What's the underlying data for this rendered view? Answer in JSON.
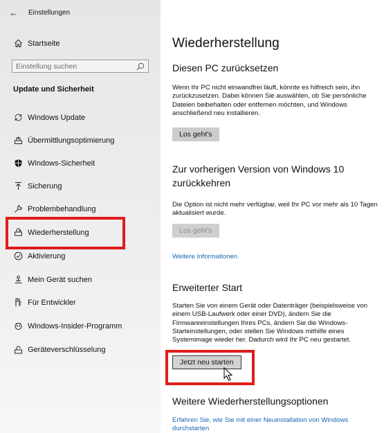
{
  "window": {
    "title": "Einstellungen"
  },
  "sidebar": {
    "home_label": "Startseite",
    "search_placeholder": "Einstellung suchen",
    "section_title": "Update und Sicherheit",
    "items": [
      {
        "label": "Windows Update",
        "icon": "sync-icon"
      },
      {
        "label": "Übermittlungsoptimierung",
        "icon": "delivery-optimization-icon"
      },
      {
        "label": "Windows-Sicherheit",
        "icon": "shield-icon"
      },
      {
        "label": "Sicherung",
        "icon": "backup-arrow-icon"
      },
      {
        "label": "Problembehandlung",
        "icon": "wrench-icon"
      },
      {
        "label": "Wiederherstellung",
        "icon": "recovery-icon",
        "selected": true
      },
      {
        "label": "Aktivierung",
        "icon": "check-circle-icon"
      },
      {
        "label": "Mein Gerät suchen",
        "icon": "find-device-icon"
      },
      {
        "label": "Für Entwickler",
        "icon": "developer-icon"
      },
      {
        "label": "Windows-Insider-Programm",
        "icon": "insider-icon"
      },
      {
        "label": "Geräteverschlüsselung",
        "icon": "lock-icon"
      }
    ]
  },
  "main": {
    "title": "Wiederherstellung",
    "reset": {
      "heading": "Diesen PC zurücksetzen",
      "text": "Wenn Ihr PC nicht einwandfrei läuft, könnte es hilfreich sein, ihn zurückzusetzen. Dabei können Sie auswählen, ob Sie persönliche Dateien beibehalten oder entfernen möchten, und Windows anschließend neu installieren.",
      "button": "Los geht's"
    },
    "previous": {
      "heading": "Zur vorherigen Version von Windows 10 zurückkehren",
      "text": "Die Option ist nicht mehr verfügbar, weil Ihr PC vor mehr als 10 Tagen aktualisiert wurde.",
      "button": "Los geht's",
      "link": "Weitere Informationen"
    },
    "advanced": {
      "heading": "Erweiterter Start",
      "text": "Starten Sie von einem Gerät oder Datenträger (beispielsweise von einem USB-Laufwerk oder einer DVD), ändern Sie die Firmwareeinstellungen Ihres PCs, ändern Sie die Windows-Starteinstellungen, oder stellen Sie Windows mithilfe eines Systemimage wieder her. Dadurch wird Ihr PC neu gestartet.",
      "button": "Jetzt neu starten"
    },
    "more": {
      "heading": "Weitere Wiederherstellungsoptionen",
      "link": "Erfahren Sie, wie Sie mit einer Neuinstallation von Windows durchstarten"
    }
  },
  "colors": {
    "highlight": "#e01b1b",
    "link": "#1565b5",
    "sidebar_bg": "#ececec",
    "button_bg": "#cccccc"
  }
}
